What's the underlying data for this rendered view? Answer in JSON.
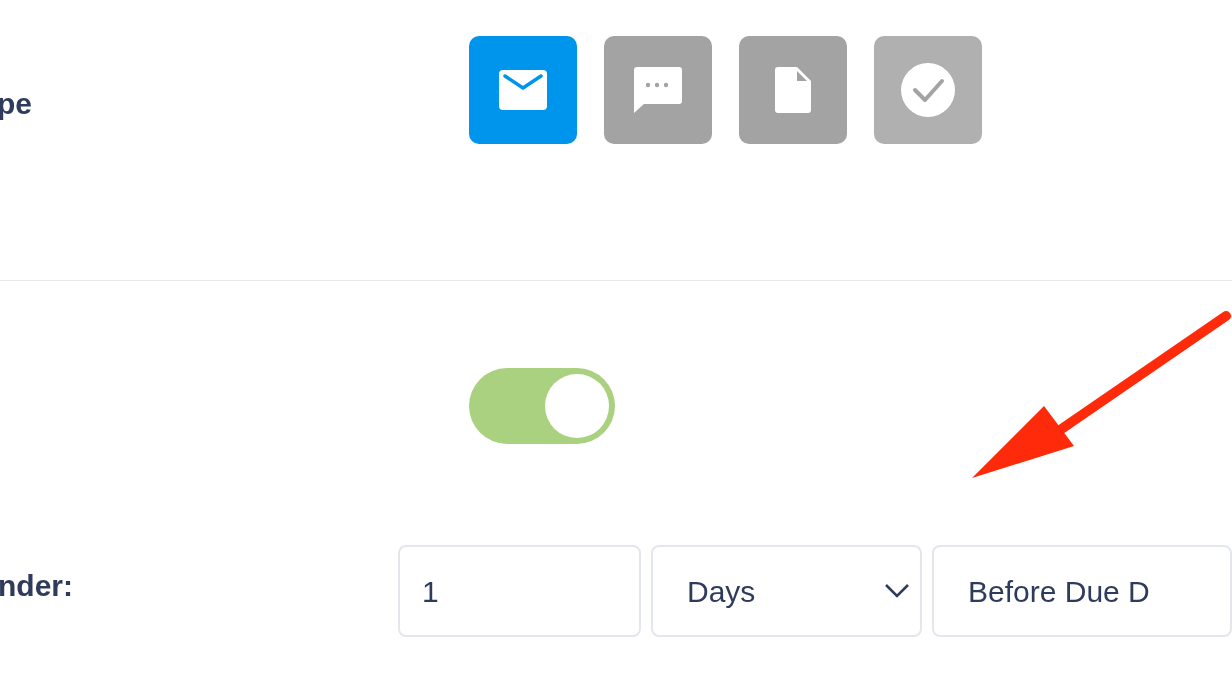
{
  "type_section": {
    "label": "pe",
    "buttons": [
      {
        "kind": "email",
        "selected": true,
        "disabled": false
      },
      {
        "kind": "chat",
        "selected": false,
        "disabled": false
      },
      {
        "kind": "document",
        "selected": false,
        "disabled": false
      },
      {
        "kind": "check",
        "selected": false,
        "disabled": true
      }
    ]
  },
  "toggle": {
    "on": true
  },
  "reminder": {
    "label": "nder:",
    "amount": "1",
    "unit": "Days",
    "timing": "Before Due D"
  }
}
